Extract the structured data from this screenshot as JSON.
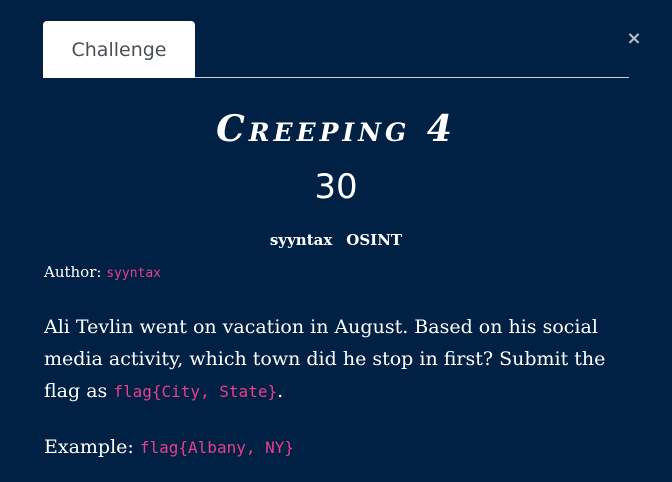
{
  "tabs": [
    {
      "label": "Challenge"
    }
  ],
  "close_icon": "×",
  "challenge": {
    "name": "Creeping 4",
    "points": "30",
    "tags": [
      "syyntax",
      "OSINT"
    ],
    "author_label": "Author:",
    "author": "syyntax",
    "description_part1": "Ali Tevlin went on vacation in August. Based on his social media activity, which town did he stop in first? Submit the flag as ",
    "flag_format": "flag{City, State}",
    "description_end": ".",
    "example_label": "Example:",
    "example_flag": "flag{Albany, NY}"
  },
  "colors": {
    "background": "#002144",
    "code": "#e83e8c",
    "tab_background": "#ffffff"
  }
}
